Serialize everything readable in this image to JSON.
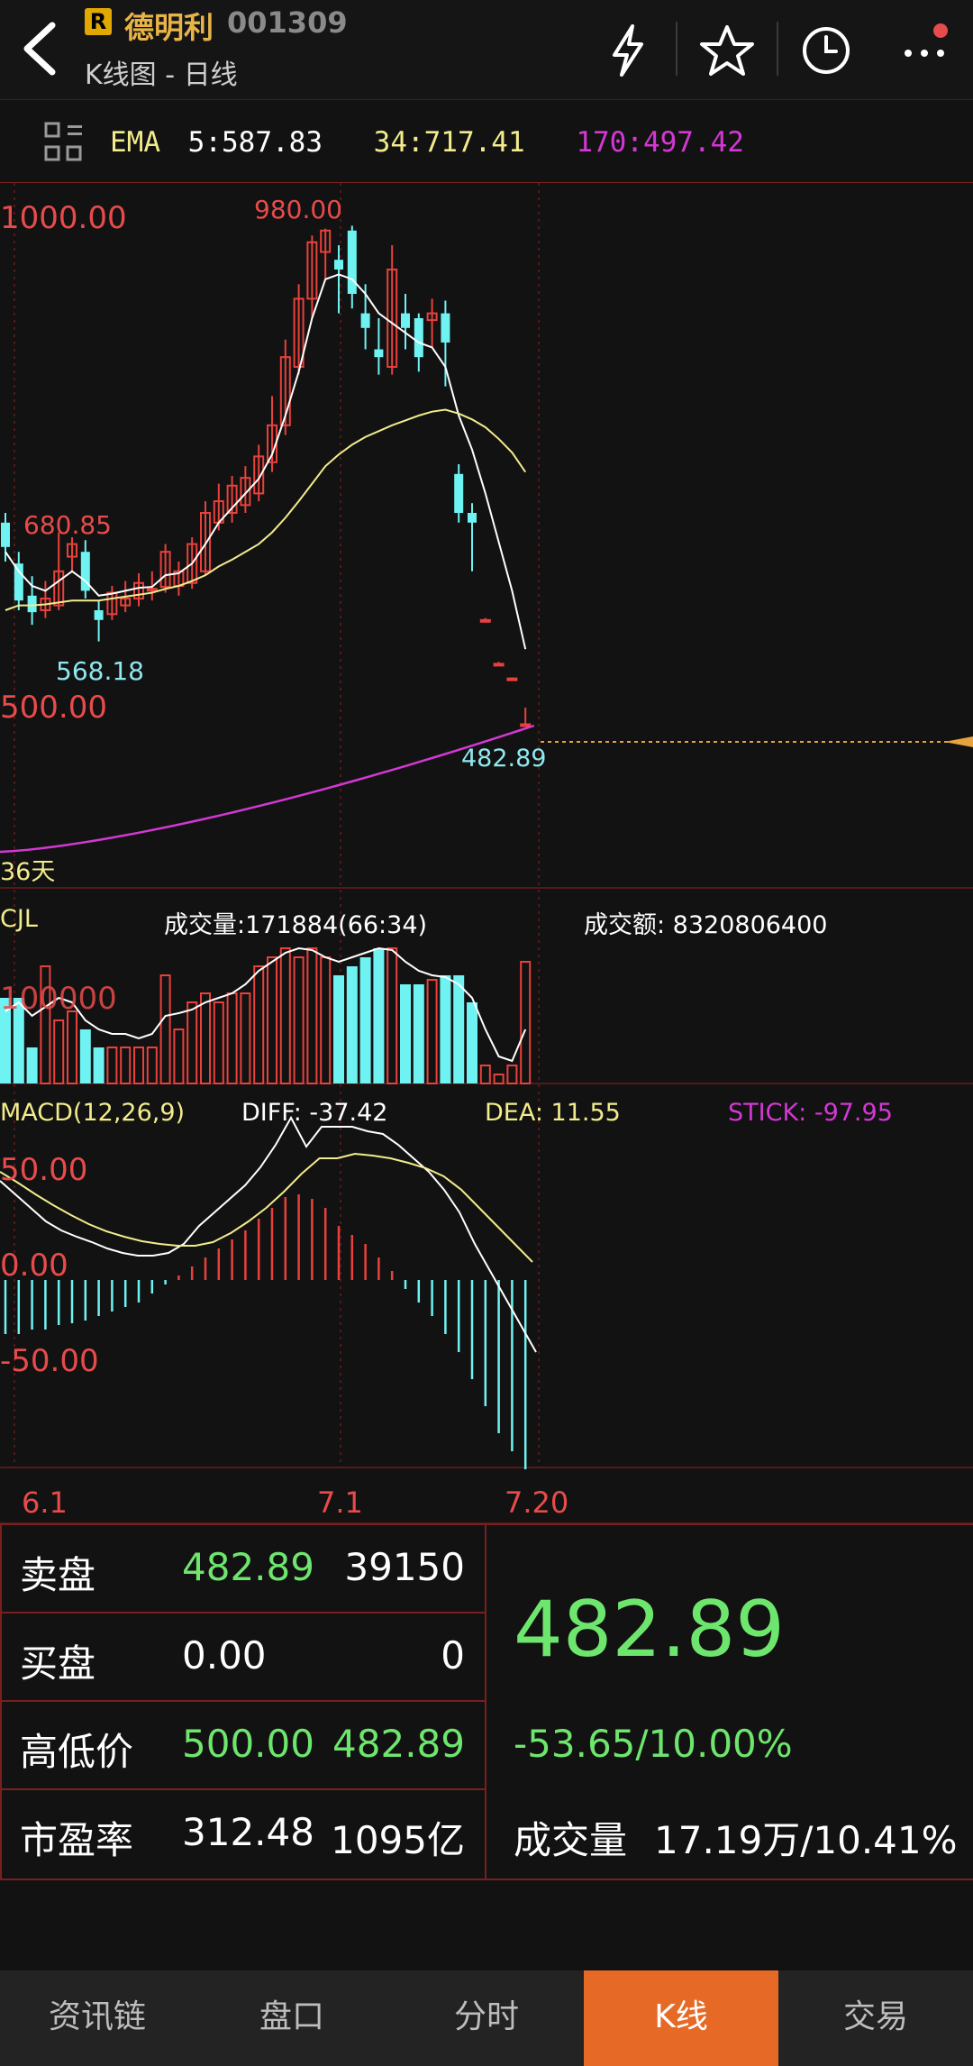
{
  "header": {
    "badge": "R",
    "stock_name": "德明利",
    "stock_code": "001309",
    "subtitle": "K线图 - 日线"
  },
  "ema": {
    "label": "EMA",
    "ema5": "5:587.83",
    "ema34": "34:717.41",
    "ema170": "170:497.42"
  },
  "kline": {
    "axis_top": "1000.00",
    "axis_bottom": "500.00",
    "high_label": "980.00",
    "mid_label": "680.85",
    "low_label": "568.18",
    "last_price_label": "482.89",
    "days_label": "36天"
  },
  "volume": {
    "title": "CJL",
    "volume_label": "成交量:171884(66:34)",
    "amount_label": "成交额: 8320806400",
    "axis_label": "100000"
  },
  "macd": {
    "title": "MACD(12,26,9)",
    "diff": "DIFF: -37.42",
    "dea": "DEA: 11.55",
    "stick": "STICK: -97.95",
    "axis_top": "50.00",
    "axis_mid": "0.00",
    "axis_bottom": "-50.00"
  },
  "dates": [
    "6.1",
    "7.1",
    "7.20"
  ],
  "quote": {
    "sell_label": "卖盘",
    "sell_price": "482.89",
    "sell_vol": "39150",
    "buy_label": "买盘",
    "buy_price": "0.00",
    "buy_vol": "0",
    "hl_label": "高低价",
    "high": "500.00",
    "low": "482.89",
    "pe_label": "市盈率",
    "pe": "312.48",
    "mcap": "1095亿",
    "price": "482.89",
    "change": "-53.65/10.00%",
    "vol_label": "成交量",
    "vol_value": "17.19万/10.41%"
  },
  "nav": {
    "items": [
      "资讯链",
      "盘口",
      "分时",
      "K线",
      "交易"
    ],
    "active": "K线"
  },
  "colors": {
    "up": "#e8413c",
    "down": "#6ff2f2",
    "green": "#6ee66e",
    "accent": "#e66a26",
    "ema5": "#ffffff",
    "ema34": "#f2ec8c",
    "ema170": "#d438d4"
  }
}
